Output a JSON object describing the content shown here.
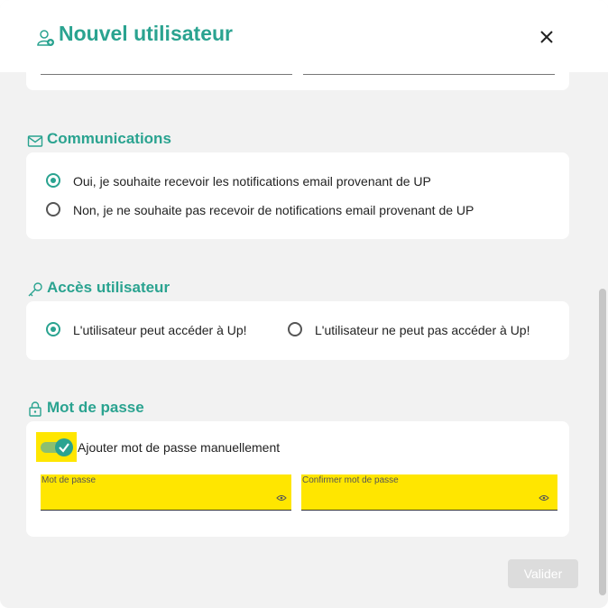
{
  "dialog": {
    "title": "Nouvel utilisateur",
    "title_icon": "user-add-icon",
    "close_icon": "close-icon"
  },
  "communications": {
    "title": "Communications",
    "icon": "mail-icon",
    "options": [
      {
        "label": "Oui, je souhaite recevoir les notifications email provenant de UP",
        "checked": true
      },
      {
        "label": "Non, je ne souhaite pas recevoir de notifications email provenant de UP",
        "checked": false
      }
    ]
  },
  "access": {
    "title": "Accès utilisateur",
    "icon": "key-icon",
    "options": [
      {
        "label": "L'utilisateur peut accéder à Up!",
        "checked": true
      },
      {
        "label": "L'utilisateur ne peut pas accéder à Up!",
        "checked": false
      }
    ]
  },
  "password": {
    "title": "Mot de passe",
    "icon": "lock-icon",
    "toggle_label": "Ajouter mot de passe manuellement",
    "toggle_on": true,
    "fields": [
      {
        "label": "Mot de passe",
        "value": ""
      },
      {
        "label": "Confirmer mot de passe",
        "value": ""
      }
    ]
  },
  "actions": {
    "submit_label": "Valider"
  },
  "colors": {
    "accent": "#2aa390",
    "highlight": "#ffe600",
    "background": "#f2f2f2"
  }
}
